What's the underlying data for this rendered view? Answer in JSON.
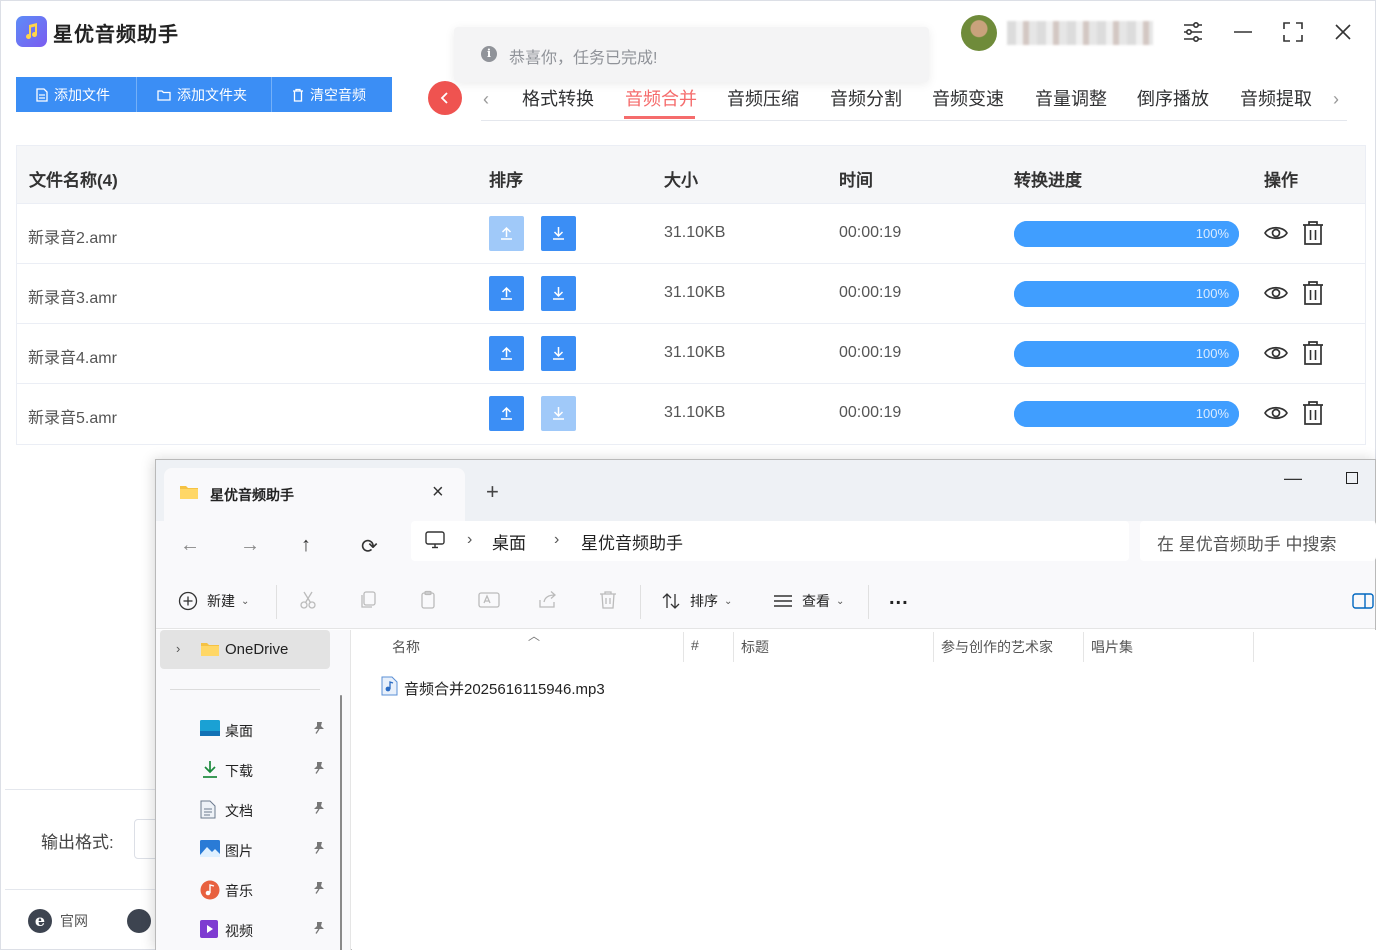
{
  "app": {
    "title": "星优音频助手",
    "toast": "恭喜你，任务已完成!",
    "toolbar": {
      "add_file": "添加文件",
      "add_folder": "添加文件夹",
      "clear": "清空音频"
    },
    "tabs": [
      "格式转换",
      "音频合并",
      "音频压缩",
      "音频分割",
      "音频变速",
      "音量调整",
      "倒序播放",
      "音频提取"
    ],
    "active_tab": "音频合并",
    "table": {
      "headers": {
        "name": "文件名称(4)",
        "sort": "排序",
        "size": "大小",
        "time": "时间",
        "progress": "转换进度",
        "ops": "操作"
      },
      "rows": [
        {
          "name": "新录音2.amr",
          "size": "31.10KB",
          "time": "00:00:19",
          "progress": 1.0,
          "progress_label": "100%",
          "up_disabled": true,
          "down_disabled": false
        },
        {
          "name": "新录音3.amr",
          "size": "31.10KB",
          "time": "00:00:19",
          "progress": 1.0,
          "progress_label": "100%",
          "up_disabled": false,
          "down_disabled": false
        },
        {
          "name": "新录音4.amr",
          "size": "31.10KB",
          "time": "00:00:19",
          "progress": 1.0,
          "progress_label": "100%",
          "up_disabled": false,
          "down_disabled": false
        },
        {
          "name": "新录音5.amr",
          "size": "31.10KB",
          "time": "00:00:19",
          "progress": 1.0,
          "progress_label": "100%",
          "up_disabled": false,
          "down_disabled": true
        }
      ]
    },
    "output_label": "输出格式:",
    "official_site": "官网",
    "colors": {
      "primary": "#3b8ef5",
      "accent": "#f56c6c",
      "collapse": "#ef5350"
    }
  },
  "explorer": {
    "tab_title": "星优音频助手",
    "breadcrumbs": [
      "桌面",
      "星优音频助手"
    ],
    "search_placeholder": "在 星优音频助手 中搜索",
    "commands": {
      "new": "新建",
      "sort": "排序",
      "view": "查看",
      "more": "..."
    },
    "nav": {
      "onedrive": "OneDrive",
      "quick_access": [
        {
          "label": "桌面",
          "icon": "desktop-icon"
        },
        {
          "label": "下载",
          "icon": "download-icon"
        },
        {
          "label": "文档",
          "icon": "document-icon"
        },
        {
          "label": "图片",
          "icon": "picture-icon"
        },
        {
          "label": "音乐",
          "icon": "music-icon"
        },
        {
          "label": "视频",
          "icon": "video-icon"
        }
      ]
    },
    "columns": [
      "名称",
      "#",
      "标题",
      "参与创作的艺术家",
      "唱片集"
    ],
    "files": [
      {
        "name": "音频合并2025616115946.mp3"
      }
    ]
  }
}
